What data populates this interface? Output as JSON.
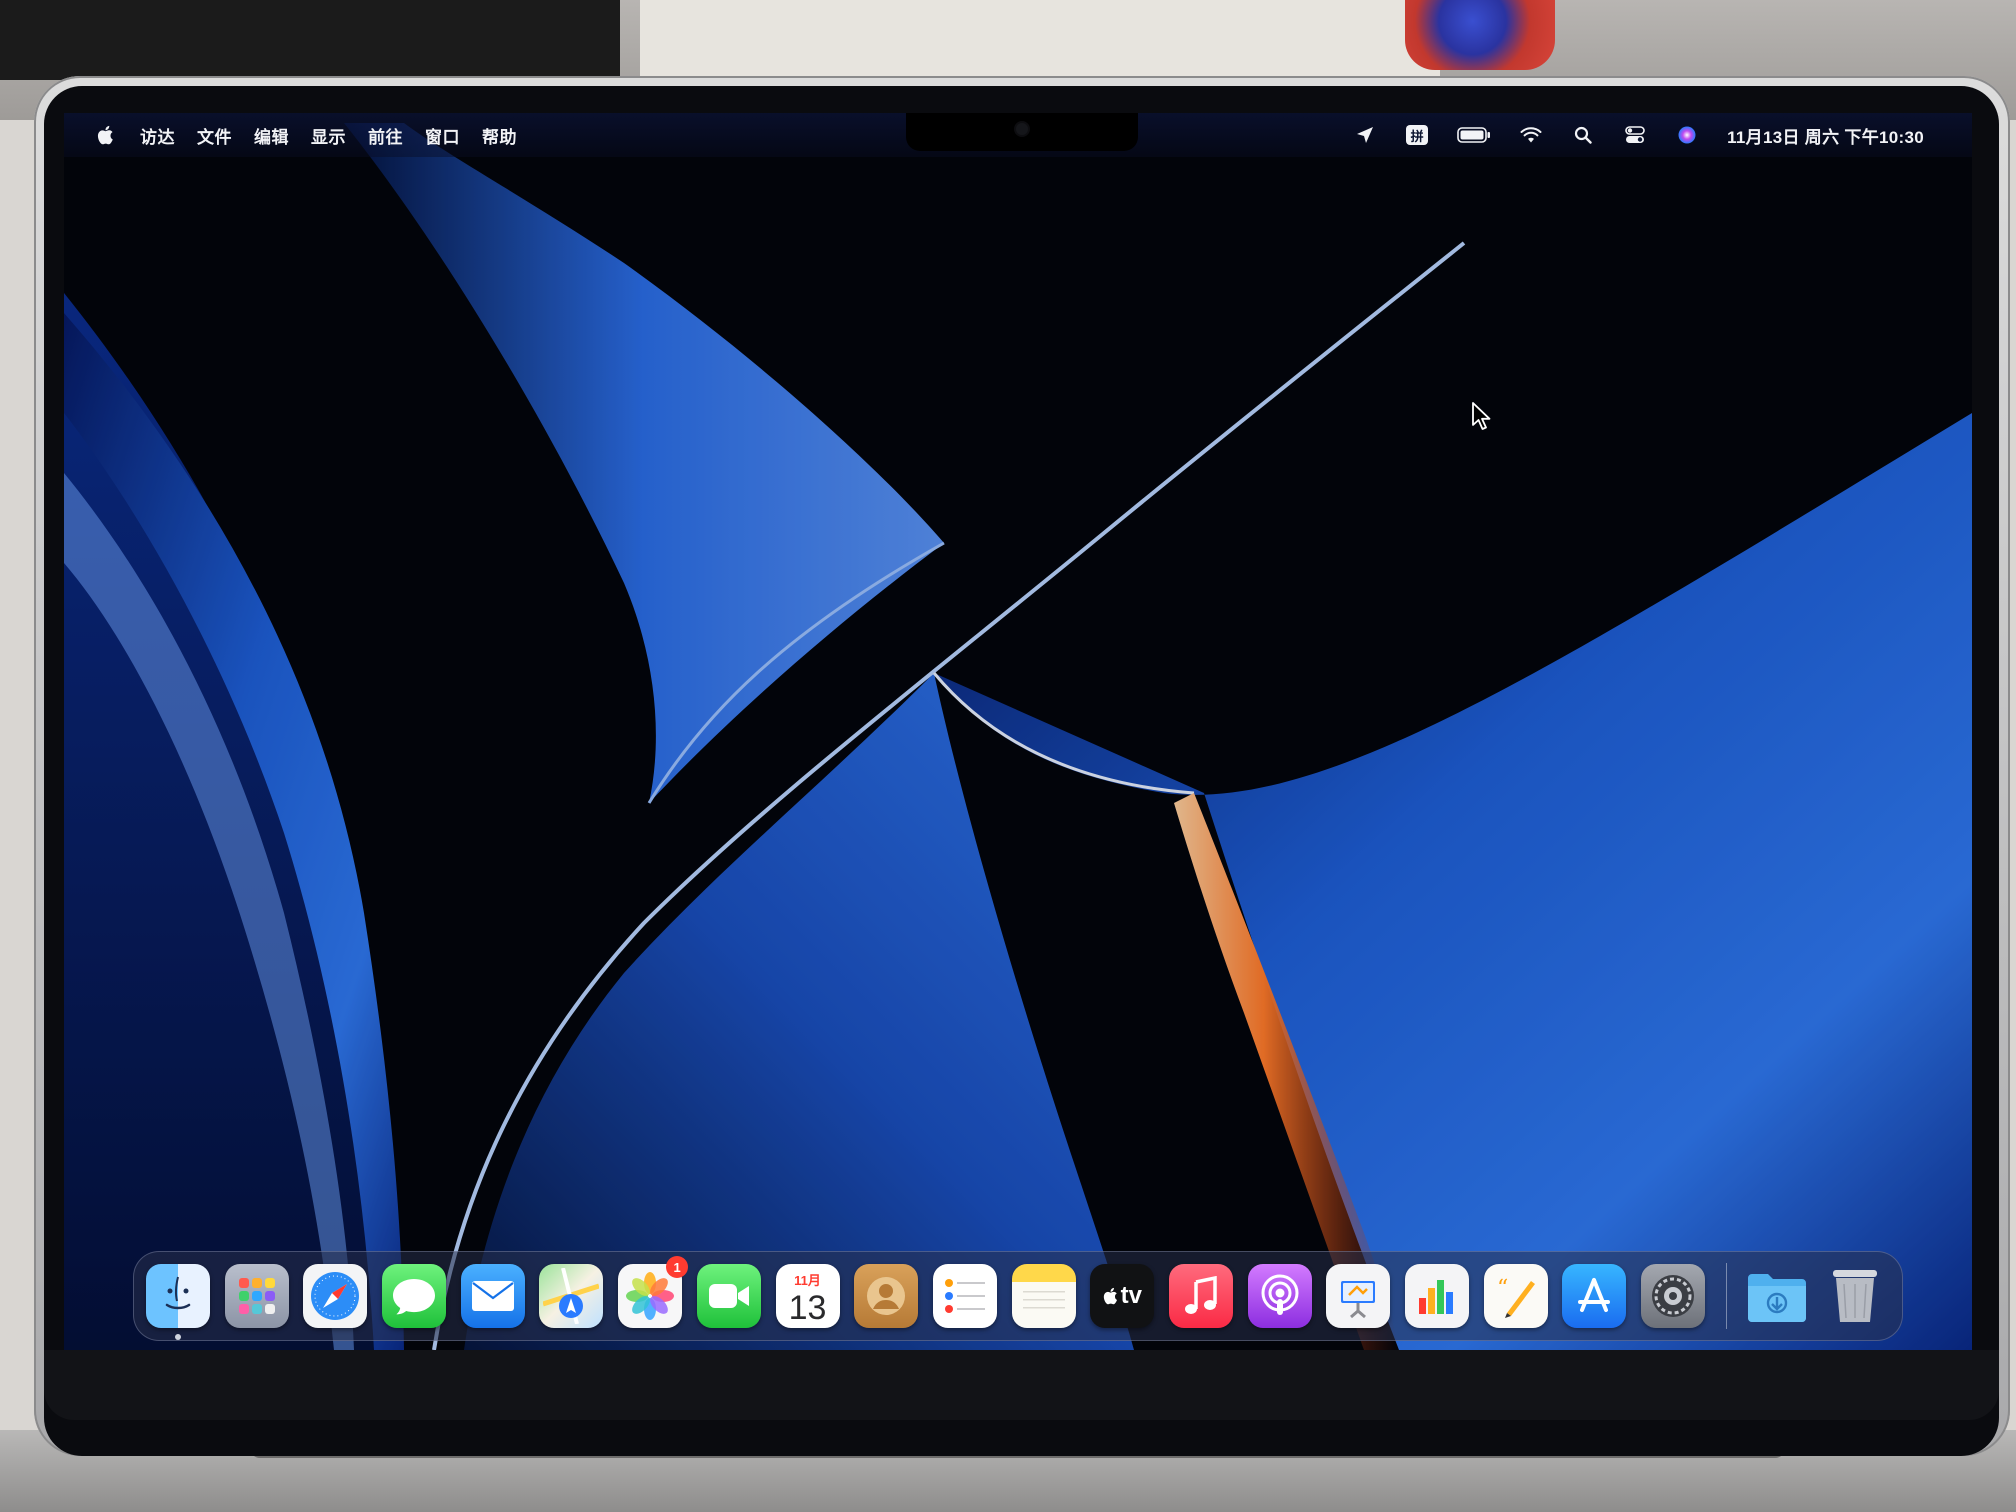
{
  "menubar": {
    "apple_menu": "",
    "items": [
      "访达",
      "文件",
      "编辑",
      "显示",
      "前往",
      "窗口",
      "帮助"
    ],
    "status_icons": [
      "location-arrow-icon",
      "input-method-icon",
      "battery-icon",
      "wifi-icon",
      "spotlight-search-icon",
      "control-center-icon",
      "siri-icon"
    ],
    "input_method_label": "拼",
    "clock": "11月13日 周六 下午10:30"
  },
  "dock": {
    "apps": [
      {
        "name": "finder",
        "icon": "finder-icon",
        "running": true
      },
      {
        "name": "launchpad",
        "icon": "launchpad-icon"
      },
      {
        "name": "safari",
        "icon": "safari-icon"
      },
      {
        "name": "messages",
        "icon": "messages-icon"
      },
      {
        "name": "mail",
        "icon": "mail-icon"
      },
      {
        "name": "maps",
        "icon": "maps-icon"
      },
      {
        "name": "photos",
        "icon": "photos-icon",
        "badge": "1"
      },
      {
        "name": "facetime",
        "icon": "facetime-icon"
      },
      {
        "name": "calendar",
        "icon": "calendar-icon",
        "month": "11月",
        "day": "13"
      },
      {
        "name": "contacts",
        "icon": "contacts-icon"
      },
      {
        "name": "reminders",
        "icon": "reminders-icon"
      },
      {
        "name": "notes",
        "icon": "notes-icon"
      },
      {
        "name": "tv",
        "icon": "apple-tv-icon",
        "label": "tv"
      },
      {
        "name": "music",
        "icon": "music-icon"
      },
      {
        "name": "podcasts",
        "icon": "podcasts-icon"
      },
      {
        "name": "keynote",
        "icon": "keynote-icon"
      },
      {
        "name": "numbers",
        "icon": "numbers-icon"
      },
      {
        "name": "pages",
        "icon": "pages-icon"
      },
      {
        "name": "app_store",
        "icon": "app-store-icon"
      },
      {
        "name": "system_preferences",
        "icon": "system-preferences-icon"
      }
    ],
    "downloads": {
      "icon": "downloads-folder-icon"
    },
    "trash": {
      "icon": "trash-icon"
    }
  },
  "colors": {
    "wallpaper_blue": "#1e5fd8",
    "wallpaper_dark": "#03050c",
    "highlight_orange": "#ff7a2a",
    "menubar_text": "#f2f3f6",
    "badge_red": "#ff3b30"
  }
}
